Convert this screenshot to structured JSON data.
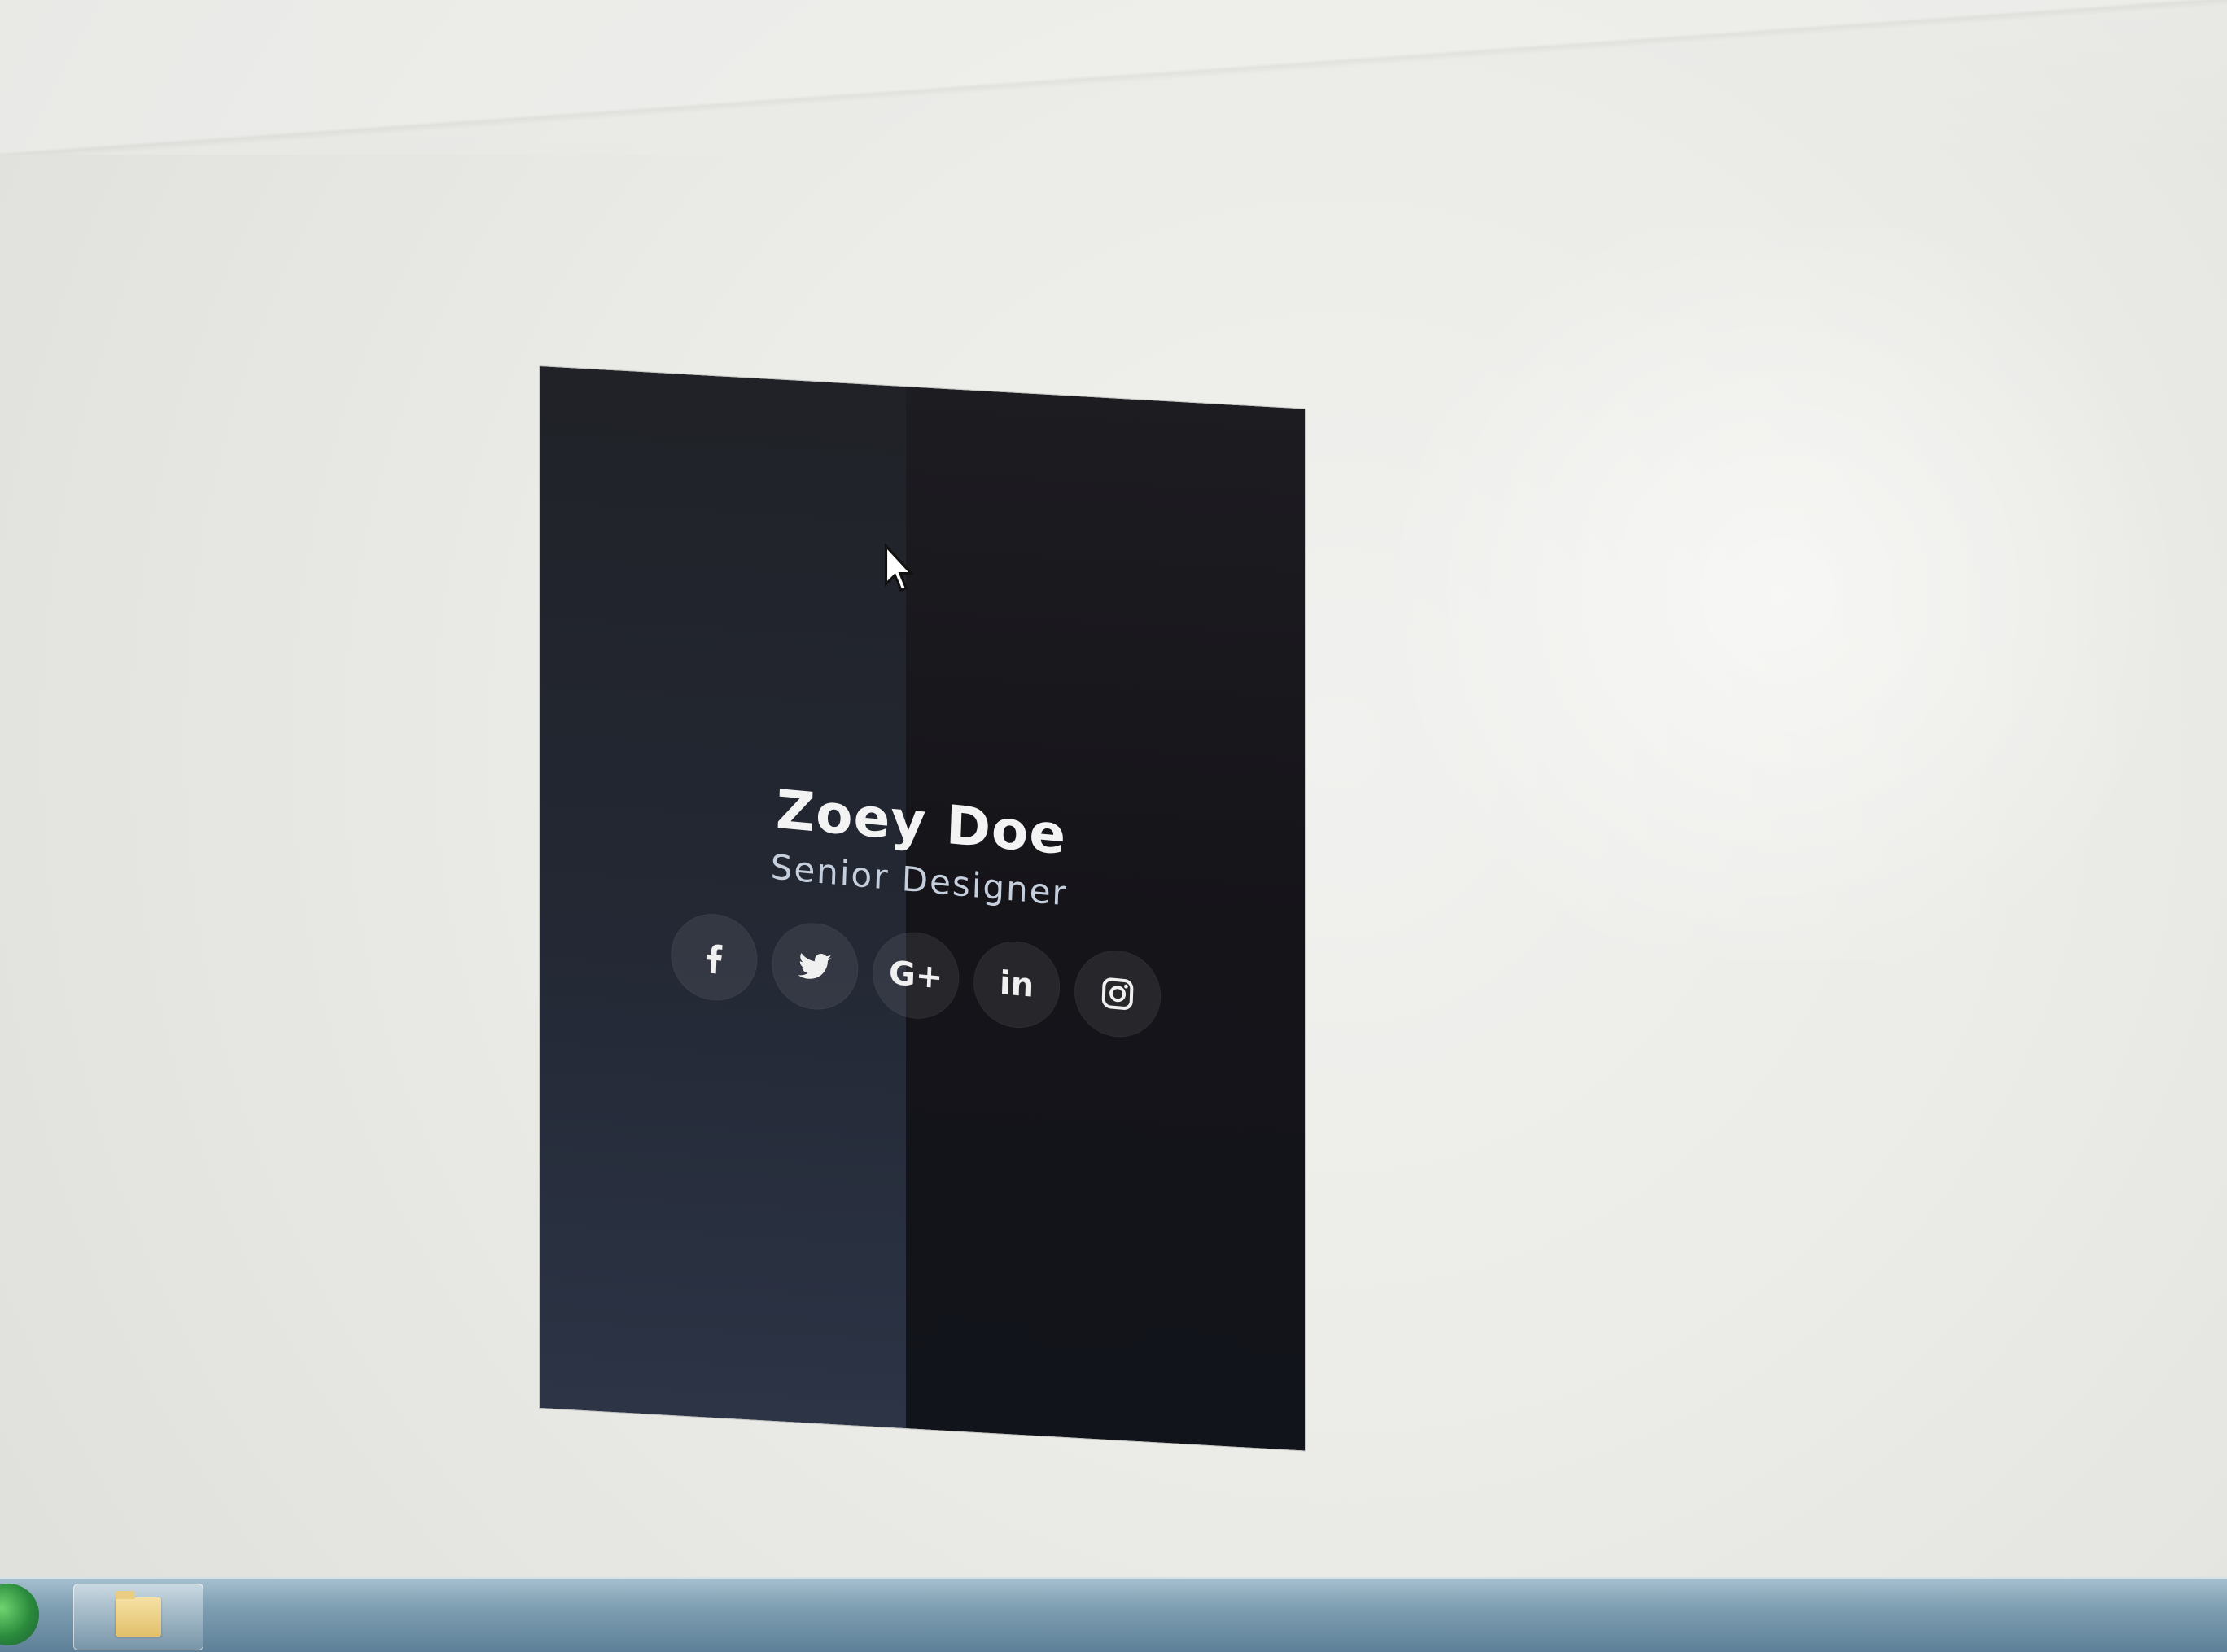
{
  "profile_card": {
    "name": "Zoey Doe",
    "role": "Senior Designer",
    "colors": {
      "panel_left": "#232834",
      "panel_right": "#151419",
      "name_text": "#f3f3f3",
      "role_text": "#c5cedc",
      "social_bg": "rgba(255,255,255,0.08)"
    },
    "social_links": [
      {
        "icon": "facebook-icon"
      },
      {
        "icon": "twitter-icon"
      },
      {
        "icon": "google-plus-icon",
        "glyph": "G+"
      },
      {
        "icon": "linkedin-icon",
        "glyph": "in"
      },
      {
        "icon": "instagram-icon"
      }
    ]
  },
  "taskbar": {
    "start_icon": "windows-start-icon",
    "pinned_items": [
      {
        "icon": "folder-icon"
      }
    ]
  },
  "cursor": {
    "icon": "mouse-pointer-icon"
  }
}
